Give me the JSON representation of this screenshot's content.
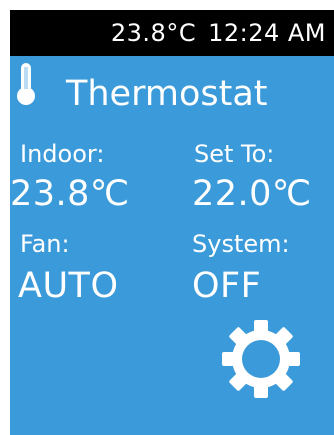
{
  "status_bar": {
    "temperature": "23.8°C",
    "time": "12:24 AM"
  },
  "header": {
    "icon": "thermometer-icon",
    "title": "Thermostat"
  },
  "readings": {
    "indoor": {
      "label": "Indoor:",
      "value": "23.8℃"
    },
    "set_to": {
      "label": "Set To:",
      "value": "22.0℃"
    },
    "fan": {
      "label": "Fan:",
      "value": "AUTO"
    },
    "system": {
      "label": "System:",
      "value": "OFF"
    }
  },
  "settings": {
    "icon": "gear-icon"
  },
  "colors": {
    "panel": "#3b9ad9",
    "status_bar": "#000000",
    "text": "#ffffff"
  }
}
